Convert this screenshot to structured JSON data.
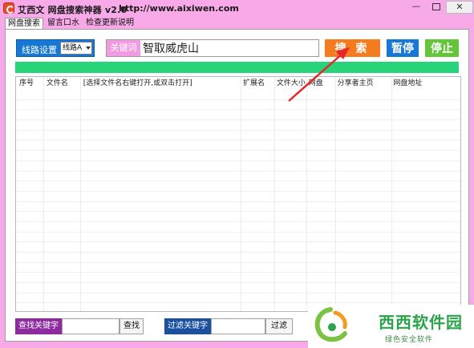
{
  "window": {
    "title": "艾西文 网盘搜索神器 v2.0",
    "url": "http://www.aixiwen.com",
    "minimize": "—",
    "close": "✕"
  },
  "tabs": [
    {
      "label": "网盘搜索",
      "active": true
    },
    {
      "label": "留言口水",
      "active": false
    },
    {
      "label": "检查更新说明",
      "active": false
    }
  ],
  "route": {
    "label": "线路设置",
    "selected": "线路A"
  },
  "keyword": {
    "label": "关键词",
    "value": "智取威虎山"
  },
  "buttons": {
    "search": "搜 索",
    "pause": "暂停",
    "stop": "停止"
  },
  "table": {
    "columns": [
      "序号",
      "文件名",
      "[选择文件名右键打开,或双击打开]",
      "扩展名",
      "文件大小",
      "网盘",
      "分享者主页",
      "网盘地址"
    ],
    "rows": []
  },
  "find": {
    "label": "查找关键字",
    "button": "查找",
    "value": ""
  },
  "filter": {
    "label": "过滤关键字",
    "button": "过滤",
    "value": ""
  },
  "watermark": {
    "brand": "西西软件园",
    "sub": "绿色安全软件"
  },
  "colors": {
    "frame": "#f7a9e8",
    "search_button": "#f47b1e",
    "pause_button": "#1677d4",
    "stop_button": "#65c53a",
    "progress": "#27d47a",
    "annotation_arrow": "#e8262a"
  }
}
